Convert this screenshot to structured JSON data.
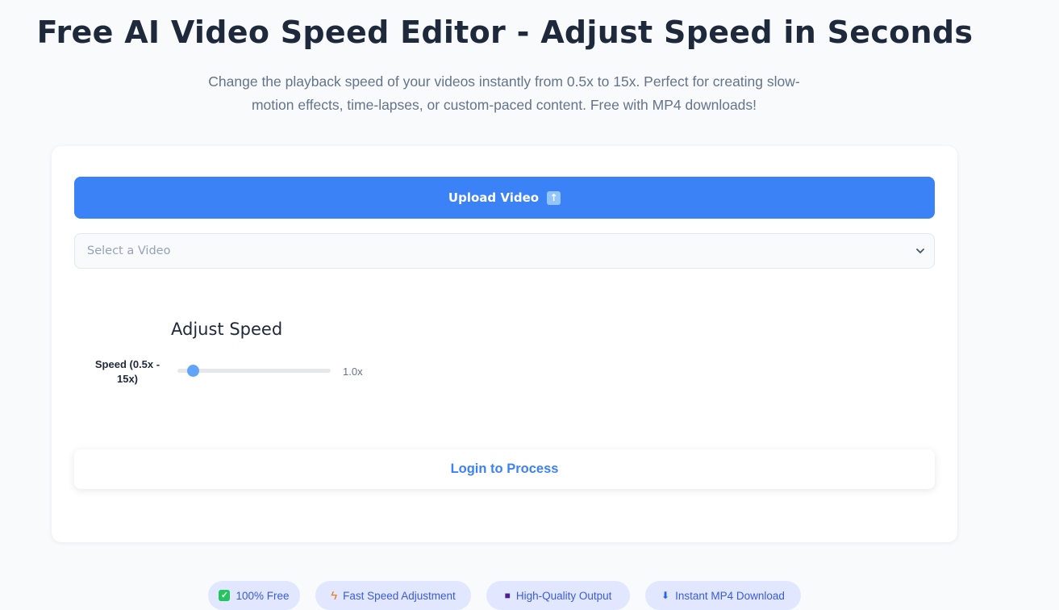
{
  "header": {
    "title": "Free AI Video Speed Editor - Adjust Speed in Seconds",
    "subtitle": "Change the playback speed of your videos instantly from 0.5x to 15x. Perfect for creating slow-motion effects, time-lapses, or custom-paced content. Free with MP4 downloads!"
  },
  "editor": {
    "upload_label": "Upload Video",
    "upload_icon": "up-arrow-icon",
    "video_select": {
      "placeholder": "Select a Video",
      "icon": "chevron-down-icon"
    },
    "speed_section": {
      "title": "Adjust Speed",
      "label": "Speed (0.5x - 15x)",
      "min": 0.5,
      "max": 15,
      "value": 1.0,
      "value_display": "1.0x"
    },
    "login_label": "Login to Process"
  },
  "features": [
    {
      "icon": "check-mark-icon",
      "label": "100% Free"
    },
    {
      "icon": "lightning-icon",
      "label": "Fast Speed Adjustment"
    },
    {
      "icon": "video-camera-icon",
      "label": "High-Quality Output"
    },
    {
      "icon": "download-icon",
      "label": "Instant MP4 Download"
    }
  ],
  "colors": {
    "primary": "#3b82f6",
    "slider_thumb": "#60a5fa",
    "title": "#1e293b",
    "muted_text": "#64748b",
    "feature_bg": "#e0e7ff"
  }
}
